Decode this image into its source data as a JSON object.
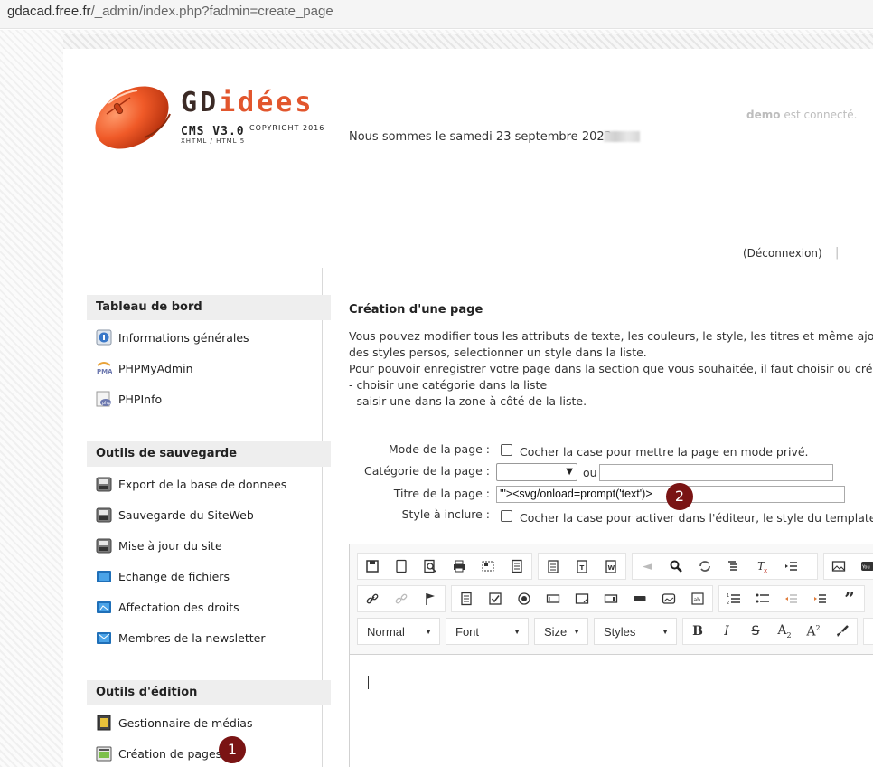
{
  "browser": {
    "url_host": "gdacad.free.fr",
    "url_path": "/_admin/index.php?fadmin=create_page"
  },
  "header": {
    "logo_title_a": "GD",
    "logo_title_b": "idées",
    "logo_version": "CMS V3.0",
    "logo_copyright": "COPYRIGHT 2016",
    "logo_sub": "XHTML / HTML 5",
    "date_text": "Nous sommes le samedi 23 septembre 2023 -",
    "user": "demo",
    "connected_text": "est connecté.",
    "logout_label": "(Déconnexion)",
    "logout_sep": "|"
  },
  "sidebar": {
    "sections": [
      {
        "title": "Tableau de bord",
        "items": [
          {
            "label": "Informations générales",
            "icon": "info-globe-icon"
          },
          {
            "label": "PHPMyAdmin",
            "icon": "phpmyadmin-icon"
          },
          {
            "label": "PHPInfo",
            "icon": "php-icon"
          }
        ]
      },
      {
        "title": "Outils de sauvegarde",
        "items": [
          {
            "label": "Export de la base de donnees",
            "icon": "database-export-icon"
          },
          {
            "label": "Sauvegarde du SiteWeb",
            "icon": "backup-icon"
          },
          {
            "label": "Mise à jour du site",
            "icon": "update-icon"
          },
          {
            "label": "Echange de fichiers",
            "icon": "file-exchange-icon"
          },
          {
            "label": "Affectation des droits",
            "icon": "rights-icon"
          },
          {
            "label": "Membres de la newsletter",
            "icon": "newsletter-icon"
          }
        ]
      },
      {
        "title": "Outils d'édition",
        "items": [
          {
            "label": "Gestionnaire de médias",
            "icon": "media-manager-icon"
          },
          {
            "label": "Création de pages",
            "icon": "create-page-icon"
          }
        ]
      }
    ]
  },
  "badges": {
    "one": "1",
    "two": "2"
  },
  "main": {
    "title": "Création d'une page",
    "intro_lines": [
      "Vous pouvez modifier tous les attributs de texte, les couleurs, le style, les titres et même ajoute",
      "des styles persos, selectionner un style dans la liste.",
      "Pour pouvoir enregistrer votre page dans la section que vous souhaitée, il faut choisir ou créer u",
      "- choisir une catégorie dans la liste",
      "- saisir une dans la zone à côté de la liste."
    ]
  },
  "form": {
    "mode_label": "Mode de la page :",
    "mode_text": "Cocher la case pour mettre la page en mode privé.",
    "category_label": "Catégorie de la page :",
    "category_or": "ou",
    "title_label": "Titre de la page :",
    "title_value": "'\"><svg/onload=prompt('text')>",
    "style_label": "Style à inclure :",
    "style_text": "Cocher la case pour activer dans l'éditeur, le style du template ch"
  },
  "editor": {
    "format_combo": "Normal",
    "font_combo": "Font",
    "size_combo": "Size",
    "styles_combo": "Styles"
  }
}
